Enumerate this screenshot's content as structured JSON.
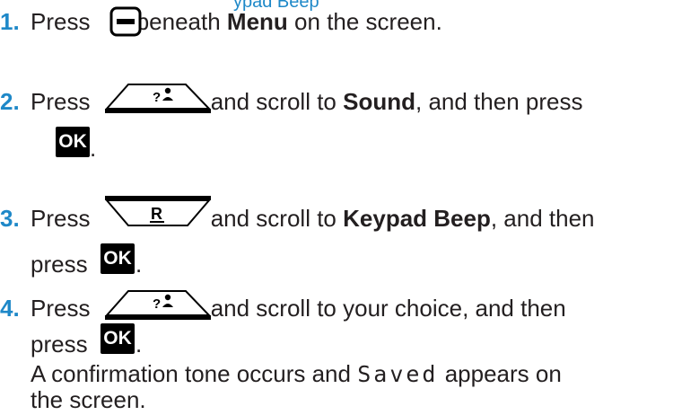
{
  "heading_fragment": "ypad Beep",
  "steps": [
    {
      "num": "1.",
      "t1": "Press",
      "t2": "beneath",
      "b1": "Menu",
      "t3": "on the screen."
    },
    {
      "num": "2.",
      "t1": "Press",
      "t2": "and scroll to",
      "b1": "Sound",
      "t3": ", and then press",
      "t4": "."
    },
    {
      "num": "3.",
      "t1": "Press",
      "t2": "and scroll to",
      "b1": "Keypad Beep",
      "t3": ", and then",
      "t4": "press",
      "t5": "."
    },
    {
      "num": "4.",
      "t1": "Press",
      "t2": "and scroll to your choice, and then",
      "t4": "press",
      "t5": "."
    }
  ],
  "note": {
    "t1": "A confirmation tone occurs and",
    "lcd": "Saved",
    "t2": "appears on",
    "t3": "the screen."
  },
  "keys": {
    "ok_label": "OK",
    "r_label": "R",
    "nav_label": "?"
  },
  "colors": {
    "step_number": "#1e88c8",
    "text": "#231f20",
    "ok_bg": "#000000"
  }
}
